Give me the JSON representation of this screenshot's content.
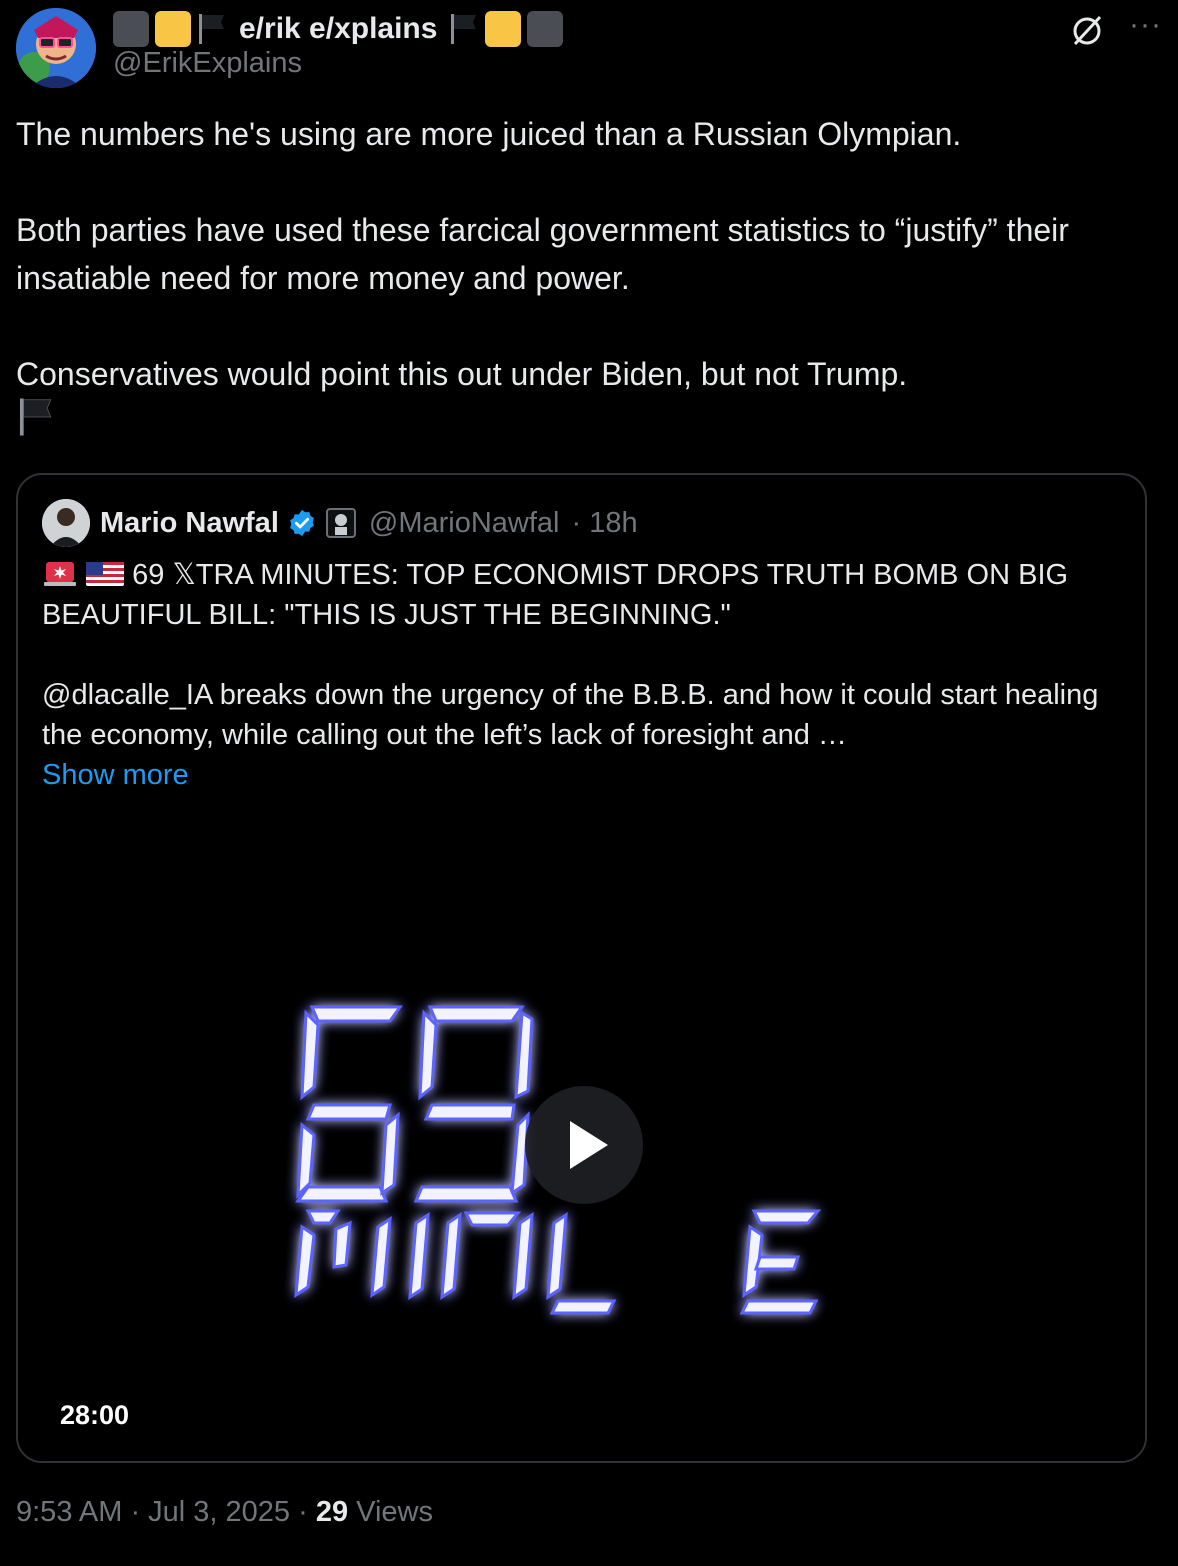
{
  "author": {
    "display_name": "e/rik e/xplains",
    "handle": "@ErikExplains"
  },
  "tweet": {
    "paragraphs": [
      "The numbers he's using are more juiced than a Russian Olympian.",
      "Both parties have used these farcical government statistics to “justify” their insatiable need for more money and power.",
      "Conservatives would point this out under Biden, but not Trump."
    ]
  },
  "quote": {
    "display_name": "Mario Nawfal",
    "handle": "@MarioNawfal",
    "time": "· 18h",
    "headline": "69 𝕏TRA MINUTES: TOP ECONOMIST DROPS TRUTH BOMB ON BIG BEAUTIFUL BILL: \"THIS IS JUST THE BEGINNING.\"",
    "body": "@dlacalle_IA breaks down the urgency of the B.B.B. and how it could start healing the economy, while calling out the left’s lack of foresight and …",
    "show_more": "Show more",
    "video": {
      "title_line1": "69",
      "title_line2": "MINUTE",
      "duration": "28:00"
    }
  },
  "meta": {
    "time": "9:53 AM · Jul 3, 2025 · ",
    "views_count": "29",
    "views_label": " Views"
  },
  "colors": {
    "accent": "#1d9bf0",
    "muted": "#71767b",
    "text": "#e7e9ea",
    "border": "#2f3336"
  }
}
